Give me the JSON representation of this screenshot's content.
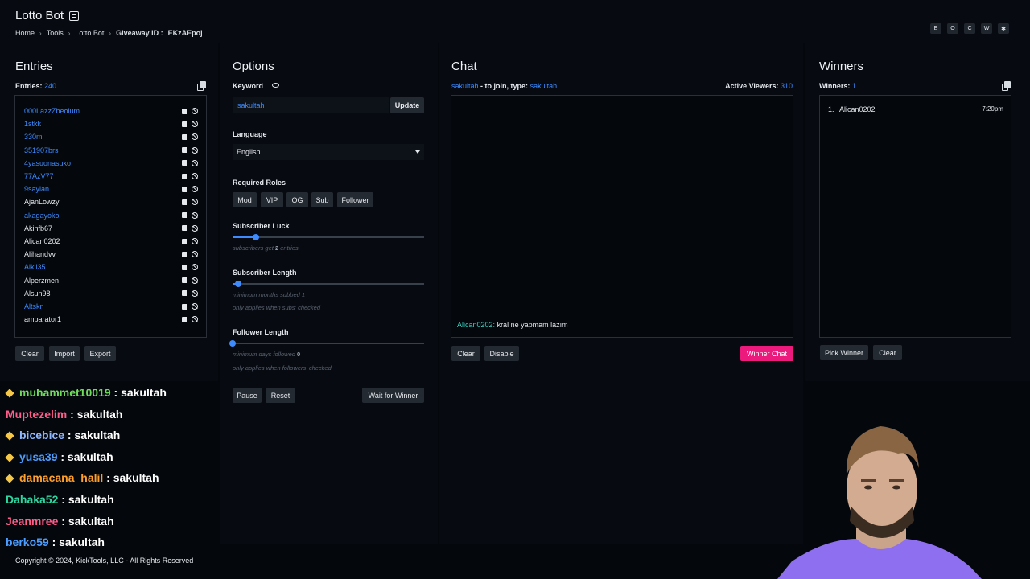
{
  "header": {
    "title": "Lotto Bot",
    "breadcrumb": [
      "Home",
      "Tools",
      "Lotto Bot"
    ],
    "giveaway_label": "Giveaway ID :",
    "giveaway_id": "EKzAEpoj",
    "corner_buttons": [
      "E",
      "O",
      "C",
      "W",
      "✱"
    ]
  },
  "entries": {
    "title": "Entries",
    "count_label": "Entries:",
    "count": "240",
    "items": [
      {
        "name": "000LazzZbeolum",
        "color": "#3d8bff"
      },
      {
        "name": "1stkk",
        "color": "#3d8bff"
      },
      {
        "name": "330ml",
        "color": "#3d8bff"
      },
      {
        "name": "351907brs",
        "color": "#3d8bff"
      },
      {
        "name": "4yasuonasuko",
        "color": "#3d8bff"
      },
      {
        "name": "77AzV77",
        "color": "#3d8bff"
      },
      {
        "name": "9saylan",
        "color": "#3d8bff"
      },
      {
        "name": "AjanLowzy",
        "color": "#e6e9ee"
      },
      {
        "name": "akagayoko",
        "color": "#3d8bff"
      },
      {
        "name": "Akinfb67",
        "color": "#e6e9ee"
      },
      {
        "name": "Alican0202",
        "color": "#e6e9ee"
      },
      {
        "name": "Alihandvv",
        "color": "#e6e9ee"
      },
      {
        "name": "Alkii35",
        "color": "#3d8bff"
      },
      {
        "name": "Alperzmen",
        "color": "#e6e9ee"
      },
      {
        "name": "Alsun98",
        "color": "#e6e9ee"
      },
      {
        "name": "Altskn",
        "color": "#3d8bff"
      },
      {
        "name": "amparator1",
        "color": "#e6e9ee"
      }
    ],
    "buttons": {
      "clear": "Clear",
      "import": "Import",
      "export": "Export"
    }
  },
  "options": {
    "title": "Options",
    "keyword_label": "Keyword",
    "keyword_value": "sakultah",
    "update_button": "Update",
    "language_label": "Language",
    "language_value": "English",
    "roles_label": "Required Roles",
    "roles": [
      "Mod",
      "VIP",
      "OG",
      "Sub",
      "Follower"
    ],
    "sub_luck_label": "Subscriber Luck",
    "sub_luck_hint_pre": "subscribers get",
    "sub_luck_value": "2",
    "sub_luck_hint_post": "entries",
    "sub_luck_fraction": 0.12,
    "sub_length_label": "Subscriber Length",
    "sub_length_hint": "minimum months subbed 1",
    "sub_length_note": "only applies when subs' checked",
    "sub_length_fraction": 0.03,
    "follower_length_label": "Follower Length",
    "follower_length_hint_pre": "minimum days followed",
    "follower_length_value": "0",
    "follower_length_note": "only applies when followers' checked",
    "follower_length_fraction": 0.0,
    "pause_button": "Pause",
    "reset_button": "Reset",
    "wait_button": "Wait for Winner"
  },
  "chat": {
    "title": "Chat",
    "join_user": "sakultah",
    "join_text": "- to join, type:",
    "join_keyword": "sakultah",
    "viewers_label": "Active Viewers:",
    "viewers_count": "310",
    "message_user": "Alican0202:",
    "message_text": "kral ne yapmam lazım",
    "message_user_color": "#2fd6c3",
    "clear_button": "Clear",
    "disable_button": "Disable",
    "winner_chat_button": "Winner Chat"
  },
  "winners": {
    "title": "Winners",
    "count_label": "Winners:",
    "count": "1",
    "items": [
      {
        "rank": "1.",
        "name": "Alican0202",
        "time": "7:20pm"
      }
    ],
    "pick_button": "Pick Winner",
    "clear_button": "Clear"
  },
  "overlay_chat": [
    {
      "user": "muhammet10019",
      "text": ": sakultah",
      "color": "#6edc5a",
      "badge": true
    },
    {
      "user": "Muptezelim",
      "text": ": sakultah",
      "color": "#ff5c8a",
      "badge": false
    },
    {
      "user": "bicebice",
      "text": ": sakultah",
      "color": "#8fb8ff",
      "badge": true
    },
    {
      "user": "yusa39",
      "text": ": sakultah",
      "color": "#4d9dff",
      "badge": true
    },
    {
      "user": "damacana_halil",
      "text": ": sakultah",
      "color": "#ff9f2e",
      "badge": true
    },
    {
      "user": "Dahaka52",
      "text": ": sakultah",
      "color": "#2fd6a0",
      "badge": false
    },
    {
      "user": "Jeanmree",
      "text": ": sakultah",
      "color": "#ff5c8a",
      "badge": false
    },
    {
      "user": "berko59",
      "text": ": sakultah",
      "color": "#4d9dff",
      "badge": false
    }
  ],
  "footer": {
    "copyright": "Copyright © 2024, KickTools, LLC - All Rights Reserved"
  },
  "colors": {
    "accent": "#3d8bff",
    "pink": "#ec1a7c",
    "panel": "#070b11",
    "background": "#04080d"
  }
}
